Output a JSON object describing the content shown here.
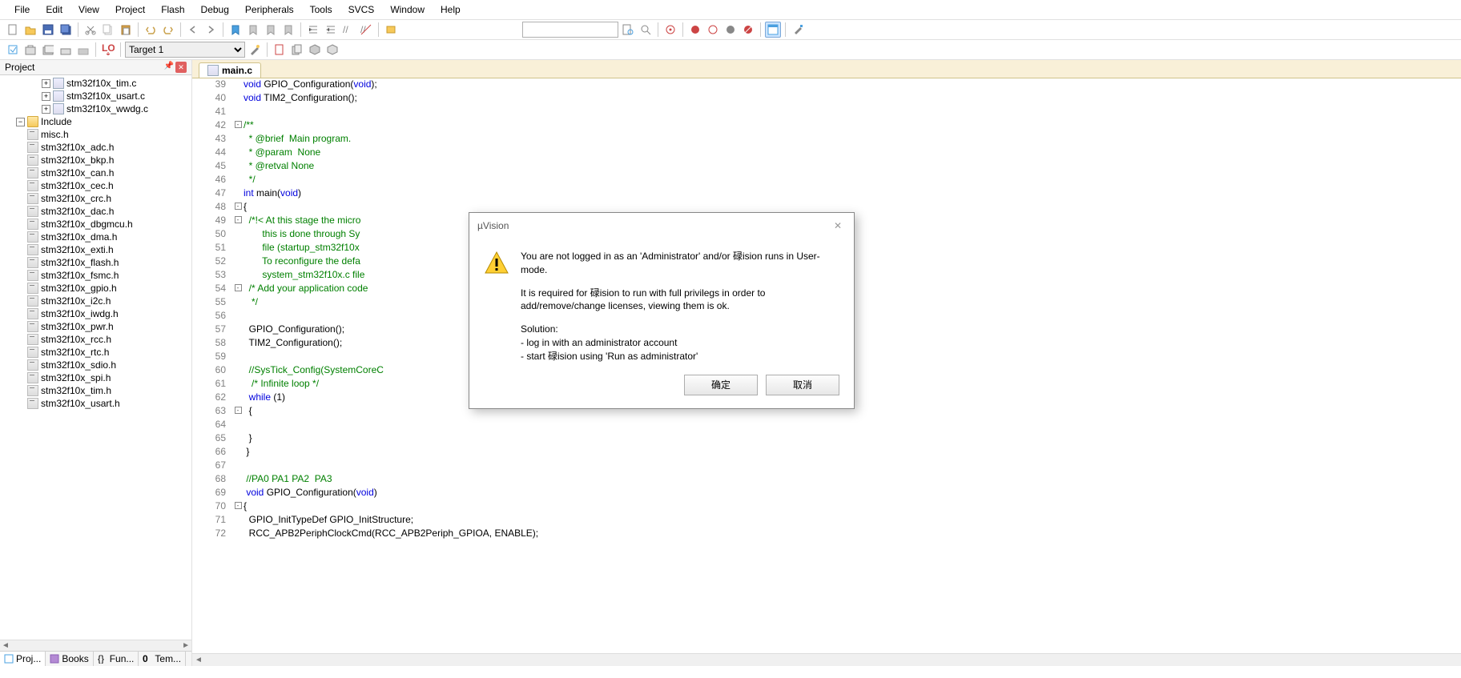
{
  "menu": [
    "File",
    "Edit",
    "View",
    "Project",
    "Flash",
    "Debug",
    "Peripherals",
    "Tools",
    "SVCS",
    "Window",
    "Help"
  ],
  "target": "Target 1",
  "project": {
    "title": "Project",
    "items": [
      {
        "type": "c",
        "name": "stm32f10x_tim.c",
        "expandable": true
      },
      {
        "type": "c",
        "name": "stm32f10x_usart.c",
        "expandable": true
      },
      {
        "type": "c",
        "name": "stm32f10x_wwdg.c",
        "expandable": true
      },
      {
        "type": "folder",
        "name": "Include",
        "expandable": true,
        "open": true
      },
      {
        "type": "h",
        "name": "misc.h"
      },
      {
        "type": "h",
        "name": "stm32f10x_adc.h"
      },
      {
        "type": "h",
        "name": "stm32f10x_bkp.h"
      },
      {
        "type": "h",
        "name": "stm32f10x_can.h"
      },
      {
        "type": "h",
        "name": "stm32f10x_cec.h"
      },
      {
        "type": "h",
        "name": "stm32f10x_crc.h"
      },
      {
        "type": "h",
        "name": "stm32f10x_dac.h"
      },
      {
        "type": "h",
        "name": "stm32f10x_dbgmcu.h"
      },
      {
        "type": "h",
        "name": "stm32f10x_dma.h"
      },
      {
        "type": "h",
        "name": "stm32f10x_exti.h"
      },
      {
        "type": "h",
        "name": "stm32f10x_flash.h"
      },
      {
        "type": "h",
        "name": "stm32f10x_fsmc.h"
      },
      {
        "type": "h",
        "name": "stm32f10x_gpio.h"
      },
      {
        "type": "h",
        "name": "stm32f10x_i2c.h"
      },
      {
        "type": "h",
        "name": "stm32f10x_iwdg.h"
      },
      {
        "type": "h",
        "name": "stm32f10x_pwr.h"
      },
      {
        "type": "h",
        "name": "stm32f10x_rcc.h"
      },
      {
        "type": "h",
        "name": "stm32f10x_rtc.h"
      },
      {
        "type": "h",
        "name": "stm32f10x_sdio.h"
      },
      {
        "type": "h",
        "name": "stm32f10x_spi.h"
      },
      {
        "type": "h",
        "name": "stm32f10x_tim.h"
      },
      {
        "type": "h",
        "name": "stm32f10x_usart.h"
      }
    ],
    "tabs": [
      "Proj...",
      "Books",
      "Fun...",
      "Tem..."
    ]
  },
  "editor": {
    "active_tab": "main.c",
    "lines": [
      {
        "n": 39,
        "fold": "",
        "segs": [
          {
            "t": "void",
            "c": "kw"
          },
          {
            "t": " GPIO_Configuration("
          },
          {
            "t": "void",
            "c": "kw"
          },
          {
            "t": ");"
          }
        ]
      },
      {
        "n": 40,
        "fold": "",
        "segs": [
          {
            "t": "void",
            "c": "kw"
          },
          {
            "t": " TIM2_Configuration();"
          }
        ]
      },
      {
        "n": 41,
        "fold": "",
        "segs": []
      },
      {
        "n": 42,
        "fold": "-",
        "segs": [
          {
            "t": "/**",
            "c": "cm"
          }
        ]
      },
      {
        "n": 43,
        "fold": "",
        "segs": [
          {
            "t": "  * @brief  Main program.",
            "c": "cm"
          }
        ]
      },
      {
        "n": 44,
        "fold": "",
        "segs": [
          {
            "t": "  * @param  None",
            "c": "cm"
          }
        ]
      },
      {
        "n": 45,
        "fold": "",
        "segs": [
          {
            "t": "  * @retval None",
            "c": "cm"
          }
        ]
      },
      {
        "n": 46,
        "fold": "",
        "segs": [
          {
            "t": "  */",
            "c": "cm"
          }
        ]
      },
      {
        "n": 47,
        "fold": "",
        "segs": [
          {
            "t": "int",
            "c": "kw"
          },
          {
            "t": " main("
          },
          {
            "t": "void",
            "c": "kw"
          },
          {
            "t": ")"
          }
        ]
      },
      {
        "n": 48,
        "fold": "-",
        "segs": [
          {
            "t": "{"
          }
        ]
      },
      {
        "n": 49,
        "fold": "-",
        "segs": [
          {
            "t": "  /*!< At this stage the micro",
            "c": "cm"
          }
        ]
      },
      {
        "n": 50,
        "fold": "",
        "segs": [
          {
            "t": "       this is done through Sy",
            "c": "cm"
          }
        ]
      },
      {
        "n": 51,
        "fold": "",
        "segs": [
          {
            "t": "       file (startup_stm32f10x",
            "c": "cm"
          }
        ]
      },
      {
        "n": 52,
        "fold": "",
        "segs": [
          {
            "t": "       To reconfigure the defa",
            "c": "cm"
          }
        ]
      },
      {
        "n": 53,
        "fold": "",
        "segs": [
          {
            "t": "       system_stm32f10x.c file",
            "c": "cm"
          }
        ]
      },
      {
        "n": 54,
        "fold": "-",
        "segs": [
          {
            "t": "  /* Add your application code",
            "c": "cm"
          }
        ]
      },
      {
        "n": 55,
        "fold": "",
        "segs": [
          {
            "t": "   */",
            "c": "cm"
          }
        ]
      },
      {
        "n": 56,
        "fold": "",
        "segs": []
      },
      {
        "n": 57,
        "fold": "",
        "segs": [
          {
            "t": "  GPIO_Configuration();"
          }
        ]
      },
      {
        "n": 58,
        "fold": "",
        "segs": [
          {
            "t": "  TIM2_Configuration();"
          }
        ]
      },
      {
        "n": 59,
        "fold": "",
        "segs": []
      },
      {
        "n": 60,
        "fold": "",
        "segs": [
          {
            "t": "  //SysTick_Config(SystemCoreC",
            "c": "cm"
          }
        ]
      },
      {
        "n": 61,
        "fold": "",
        "segs": [
          {
            "t": "   /* Infinite loop */",
            "c": "cm"
          }
        ]
      },
      {
        "n": 62,
        "fold": "",
        "segs": [
          {
            "t": "  "
          },
          {
            "t": "while",
            "c": "kw"
          },
          {
            "t": " (1)"
          }
        ]
      },
      {
        "n": 63,
        "fold": "-",
        "segs": [
          {
            "t": "  {"
          }
        ]
      },
      {
        "n": 64,
        "fold": "",
        "segs": []
      },
      {
        "n": 65,
        "fold": "",
        "segs": [
          {
            "t": "  }"
          }
        ]
      },
      {
        "n": 66,
        "fold": "",
        "segs": [
          {
            "t": " }"
          }
        ]
      },
      {
        "n": 67,
        "fold": "",
        "segs": []
      },
      {
        "n": 68,
        "fold": "",
        "segs": [
          {
            "t": " //PA0 PA1 PA2  PA3",
            "c": "cm"
          }
        ]
      },
      {
        "n": 69,
        "fold": "",
        "segs": [
          {
            "t": " "
          },
          {
            "t": "void",
            "c": "kw"
          },
          {
            "t": " GPIO_Configuration("
          },
          {
            "t": "void",
            "c": "kw"
          },
          {
            "t": ")"
          }
        ]
      },
      {
        "n": 70,
        "fold": "-",
        "segs": [
          {
            "t": "{"
          }
        ]
      },
      {
        "n": 71,
        "fold": "",
        "segs": [
          {
            "t": "  GPIO_InitTypeDef GPIO_InitStructure;"
          }
        ]
      },
      {
        "n": 72,
        "fold": "",
        "segs": [
          {
            "t": "  RCC_APB2PeriphClockCmd(RCC_APB2Periph_GPIOA, ENABLE);"
          }
        ]
      }
    ]
  },
  "dialog": {
    "title": "µVision",
    "msg1": "You are not logged in as an 'Administrator' and/or 碌ision runs in User-mode.",
    "msg2": "It is required for 碌ision to run with full privilegs in order to add/remove/change licenses, viewing them is ok.",
    "msg3": "Solution:",
    "msg4": "  - log in with an administrator account",
    "msg5": "  - start 碌ision using 'Run as administrator'",
    "ok": "确定",
    "cancel": "取消"
  }
}
